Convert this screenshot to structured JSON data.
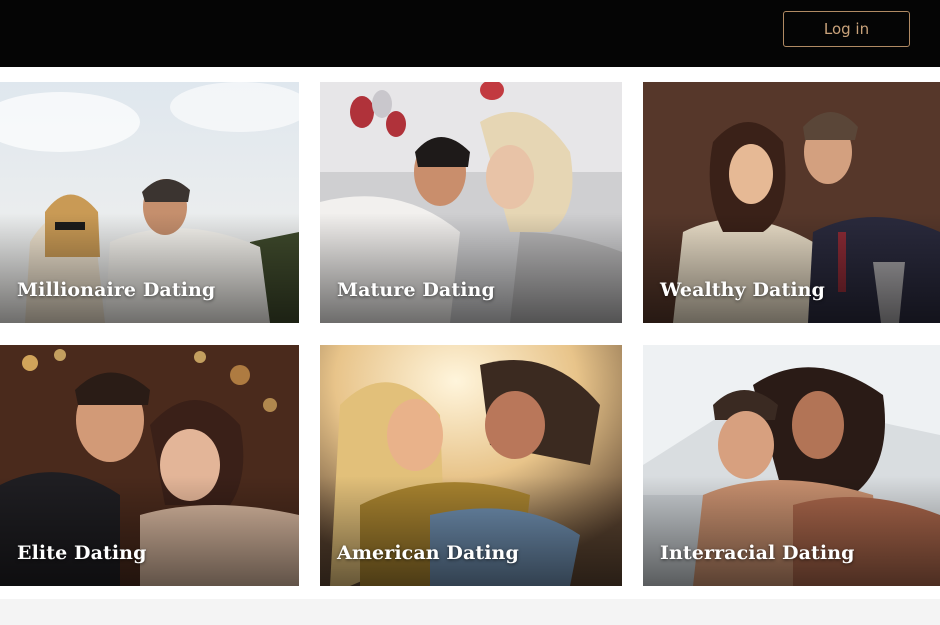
{
  "header": {
    "login_label": "Log in",
    "accent_color": "#c9a27a"
  },
  "categories": [
    {
      "label": "Millionaire Dating"
    },
    {
      "label": "Mature Dating"
    },
    {
      "label": "Wealthy Dating"
    },
    {
      "label": "Elite Dating"
    },
    {
      "label": "American Dating"
    },
    {
      "label": "Interracial Dating"
    }
  ]
}
